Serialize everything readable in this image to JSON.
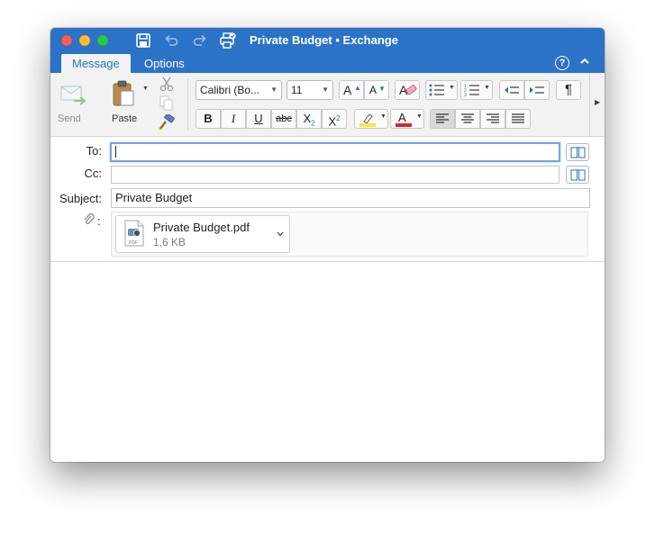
{
  "window": {
    "title": "Private Budget • Exchange"
  },
  "tabs": [
    {
      "label": "Message",
      "active": true
    },
    {
      "label": "Options",
      "active": false
    }
  ],
  "ribbon": {
    "send_label": "Send",
    "paste_label": "Paste",
    "font_name": "Calibri (Bo...",
    "font_size": "11",
    "bold": "B",
    "italic": "I",
    "underline": "U",
    "strikethrough": "abc",
    "subscript": "X",
    "superscript": "X",
    "sub_mark": "2",
    "sup_mark": "2",
    "grow_font": "A",
    "shrink_font": "A",
    "paragraph_mark": "¶",
    "text_highlight_color": "#ffe24a",
    "font_color": "#d9262b"
  },
  "header": {
    "to_label": "To:",
    "to_value": "",
    "cc_label": "Cc:",
    "cc_value": "",
    "subject_label": "Subject:",
    "subject_value": "Private Budget",
    "attach_label": ":"
  },
  "attachment": {
    "name": "Private Budget.pdf",
    "size": "1,6 KB",
    "type_tag": "PDF"
  },
  "colors": {
    "accent": "#2b73c6",
    "ribbon_bg": "#f2f2f2"
  }
}
